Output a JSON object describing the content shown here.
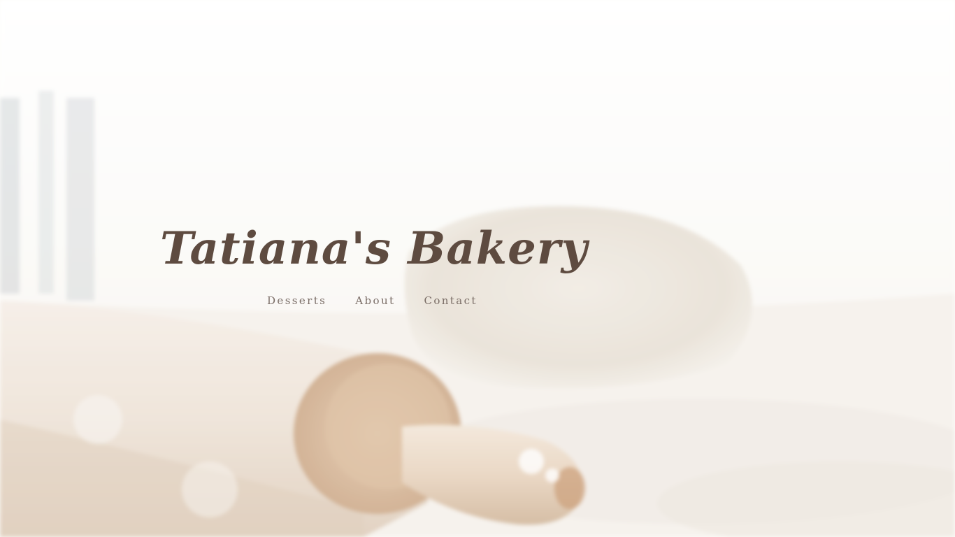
{
  "site": {
    "title": "Tatiana's Bakery"
  },
  "nav": {
    "items": [
      {
        "label": "Desserts"
      },
      {
        "label": "About"
      },
      {
        "label": "Contact"
      }
    ]
  },
  "colors": {
    "title": "#5e4b40",
    "nav_link": "#7a6d66",
    "background": "#fdfcfa"
  }
}
